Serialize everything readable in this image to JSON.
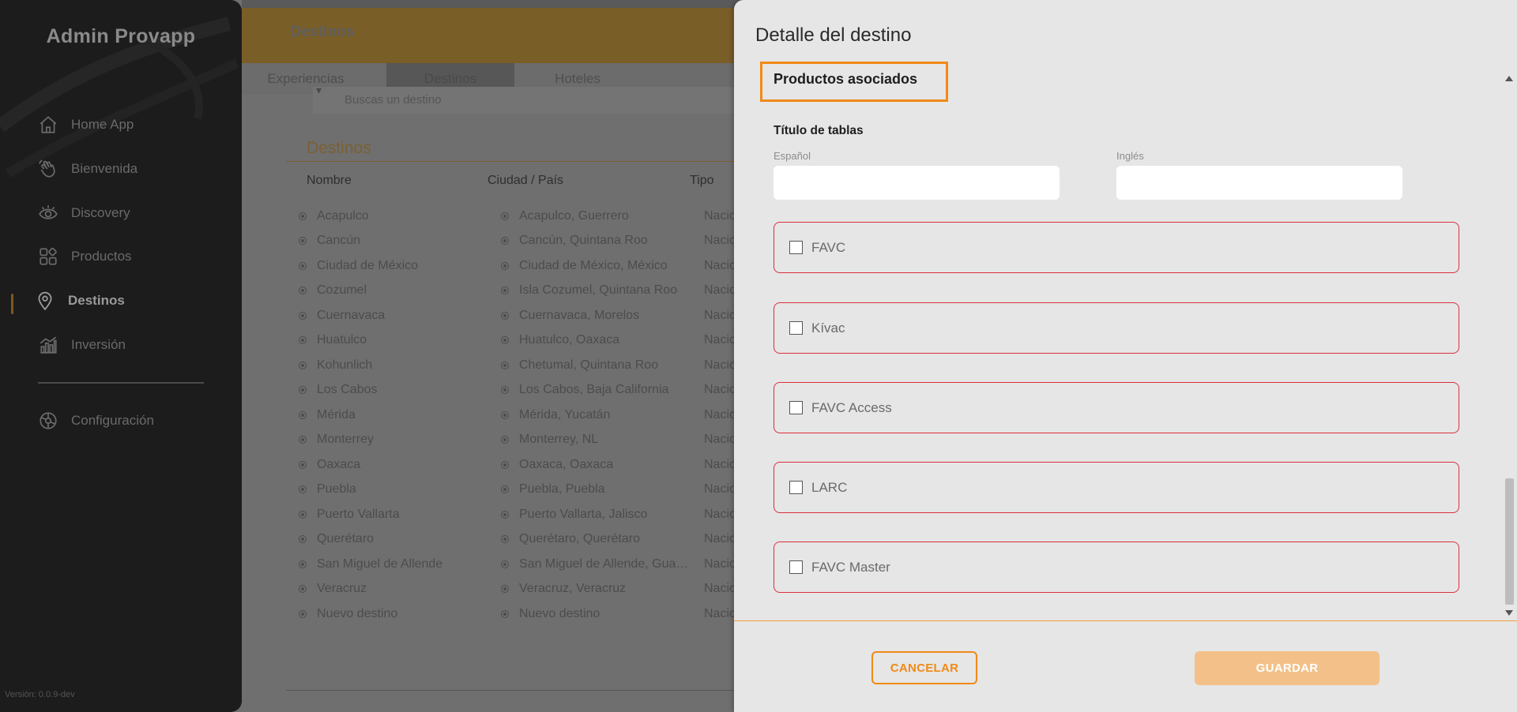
{
  "sidebar": {
    "brand": "Admin Provapp",
    "items": [
      {
        "label": "Home App",
        "icon": "home-icon"
      },
      {
        "label": "Bienvenida",
        "icon": "waving-hand-icon"
      },
      {
        "label": "Discovery",
        "icon": "eye-icon"
      },
      {
        "label": "Productos",
        "icon": "grid-icon"
      },
      {
        "label": "Destinos",
        "icon": "location-pin-icon",
        "active": true
      },
      {
        "label": "Inversión",
        "icon": "bar-chart-icon"
      }
    ],
    "settings_label": "Configuración",
    "version": "Versión: 0.0.9-dev"
  },
  "page": {
    "title": "Destinos",
    "tabs": [
      "Experiencias",
      "Destinos",
      "Hoteles"
    ],
    "active_tab": "Destinos",
    "search_placeholder": "Buscas un destino",
    "section_title": "Destinos",
    "columns": [
      "Nombre",
      "Ciudad / País",
      "Tipo"
    ],
    "rows": [
      {
        "nombre": "Acapulco",
        "ciudad": "Acapulco, Guerrero",
        "tipo": "Nacio"
      },
      {
        "nombre": "Cancún",
        "ciudad": "Cancún, Quintana Roo",
        "tipo": "Nacio"
      },
      {
        "nombre": "Ciudad de México",
        "ciudad": "Ciudad de México, México",
        "tipo": "Nacio"
      },
      {
        "nombre": "Cozumel",
        "ciudad": "Isla Cozumel, Quintana Roo",
        "tipo": "Nacio"
      },
      {
        "nombre": "Cuernavaca",
        "ciudad": "Cuernavaca, Morelos",
        "tipo": "Nacio"
      },
      {
        "nombre": "Huatulco",
        "ciudad": "Huatulco, Oaxaca",
        "tipo": "Nacio"
      },
      {
        "nombre": "Kohunlich",
        "ciudad": "Chetumal, Quintana Roo",
        "tipo": "Nacio"
      },
      {
        "nombre": "Los Cabos",
        "ciudad": "Los Cabos, Baja California",
        "tipo": "Nacio"
      },
      {
        "nombre": "Mérida",
        "ciudad": "Mérida, Yucatán",
        "tipo": "Nacio"
      },
      {
        "nombre": "Monterrey",
        "ciudad": "Monterrey, NL",
        "tipo": "Nacio"
      },
      {
        "nombre": "Oaxaca",
        "ciudad": "Oaxaca, Oaxaca",
        "tipo": "Nacio"
      },
      {
        "nombre": "Puebla",
        "ciudad": "Puebla, Puebla",
        "tipo": "Nacio"
      },
      {
        "nombre": "Puerto Vallarta",
        "ciudad": "Puerto Vallarta, Jalisco",
        "tipo": "Nacio"
      },
      {
        "nombre": "Querétaro",
        "ciudad": "Querétaro, Querétaro",
        "tipo": "Nacio"
      },
      {
        "nombre": "San Miguel de Allende",
        "ciudad": "San Miguel de Allende, Gua…",
        "tipo": "Nacio"
      },
      {
        "nombre": "Veracruz",
        "ciudad": "Veracruz, Veracruz",
        "tipo": "Nacio"
      },
      {
        "nombre": "Nuevo destino",
        "ciudad": "Nuevo destino",
        "tipo": "Nacio"
      }
    ]
  },
  "panel": {
    "title": "Detalle del destino",
    "section_label": "Productos asociados",
    "table_title_label": "Título de tablas",
    "spanish_label": "Español",
    "spanish_value": "",
    "english_label": "Inglés",
    "english_value": "",
    "products": [
      {
        "label": "FAVC",
        "checked": false
      },
      {
        "label": "Kívac",
        "checked": false
      },
      {
        "label": "FAVC Access",
        "checked": false
      },
      {
        "label": "LARC",
        "checked": false
      },
      {
        "label": "FAVC Master",
        "checked": false
      }
    ],
    "cancel_label": "CANCELAR",
    "save_label": "GUARDAR"
  },
  "colors": {
    "accent": "#f08a17",
    "save_disabled": "#f2c088",
    "error_border": "#d9303a",
    "sidebar_bg": "#1c1c1c",
    "panel_bg": "#e6e6e6"
  }
}
